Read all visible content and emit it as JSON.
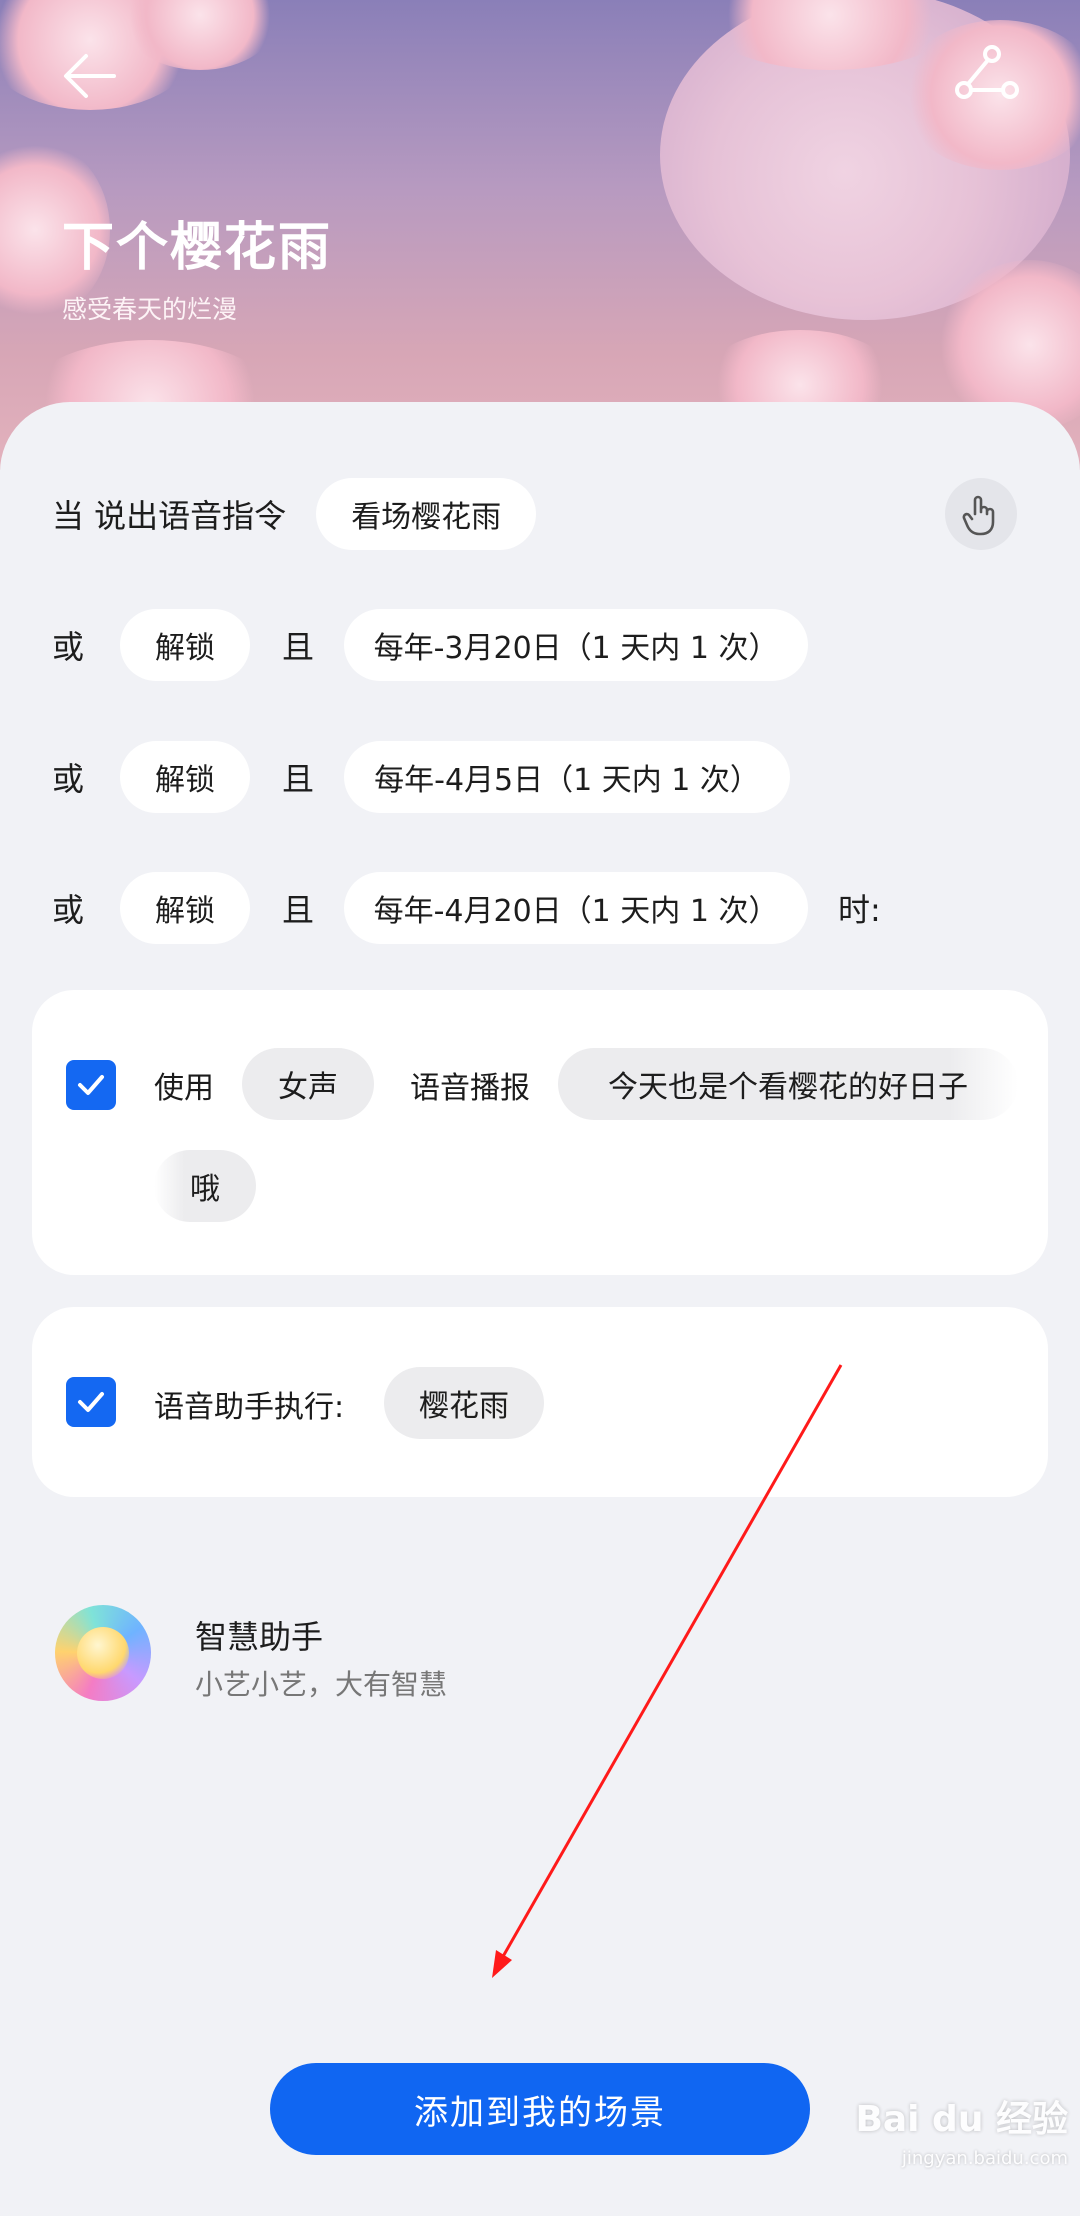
{
  "header": {
    "title": "下个樱花雨",
    "subtitle": "感受春天的烂漫",
    "back_icon": "arrow-left-icon",
    "share_icon": "share-icon"
  },
  "trigger": {
    "when_label": "当 说出语音指令",
    "voice_command": "看场樱花雨",
    "touch_icon": "touch-hand-icon"
  },
  "conditions": [
    {
      "or_label": "或",
      "event": "解锁",
      "and_label": "且",
      "schedule": "每年-3月20日（1 天内 1 次）"
    },
    {
      "or_label": "或",
      "event": "解锁",
      "and_label": "且",
      "schedule": "每年-4月5日（1 天内 1 次）"
    },
    {
      "or_label": "或",
      "event": "解锁",
      "and_label": "且",
      "schedule": "每年-4月20日（1 天内 1 次）",
      "suffix": "时:"
    }
  ],
  "action_broadcast": {
    "checked": true,
    "use_label": "使用",
    "voice": "女声",
    "broadcast_label": "语音播报",
    "text_line1": "今天也是个看樱花的好日子",
    "text_line2": "哦"
  },
  "action_assistant": {
    "checked": true,
    "label": "语音助手执行:",
    "command": "樱花雨"
  },
  "provider": {
    "name": "智慧助手",
    "tagline": "小艺小艺，大有智慧"
  },
  "primary_button": "添加到我的场景",
  "watermark": {
    "brand": "Bai du 经验",
    "url": "jingyan.baidu.com"
  },
  "colors": {
    "accent": "#1066f2",
    "annotation_arrow": "#ff1a1a"
  }
}
